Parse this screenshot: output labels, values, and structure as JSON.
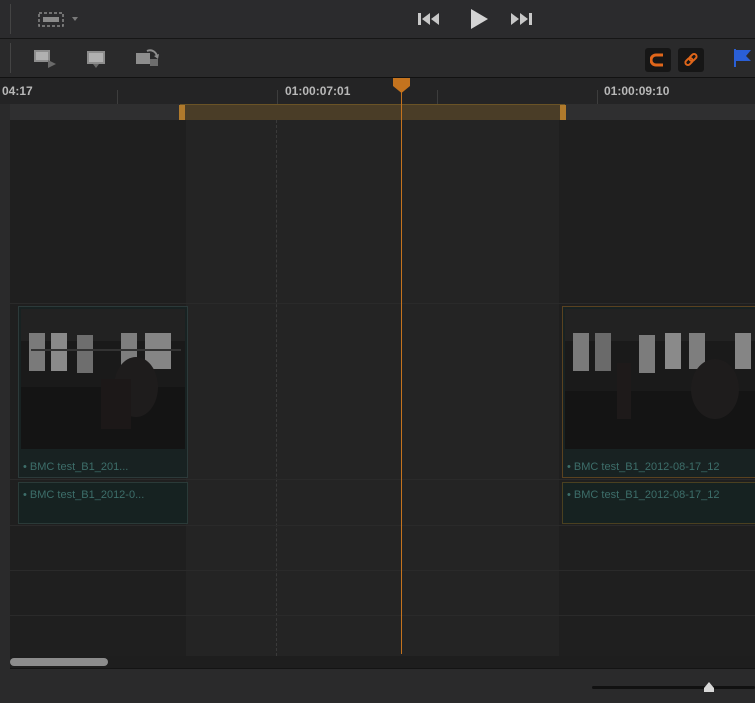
{
  "colors": {
    "accent_orange": "#c4731e",
    "clip_teal": "#3d6e6a",
    "flag_blue": "#2a5fd6",
    "bg": "#1b1b1b"
  },
  "transport": {
    "prev_icon": "skip-back-icon",
    "play_icon": "play-icon",
    "next_icon": "skip-forward-icon"
  },
  "toolbar": {
    "icons": [
      "insert-clip-icon",
      "overwrite-clip-icon",
      "replace-clip-icon"
    ],
    "snapping_icon": "snap-magnet-icon",
    "linked_icon": "link-icon",
    "flag_icon": "flag-icon"
  },
  "ruler": {
    "left_timecode": "04:17",
    "mid_timecode": "01:00:07:01",
    "right_timecode": "01:00:09:10"
  },
  "clips": {
    "left_video": "• BMC test_B1_201...",
    "left_audio": "• BMC test_B1_2012-0...",
    "right_video": "• BMC test_B1_2012-08-17_12",
    "right_audio": "• BMC test_B1_2012-08-17_12"
  },
  "scroll": {
    "horizontal_position": 0.0
  },
  "zoom": {
    "level": 0.72
  }
}
